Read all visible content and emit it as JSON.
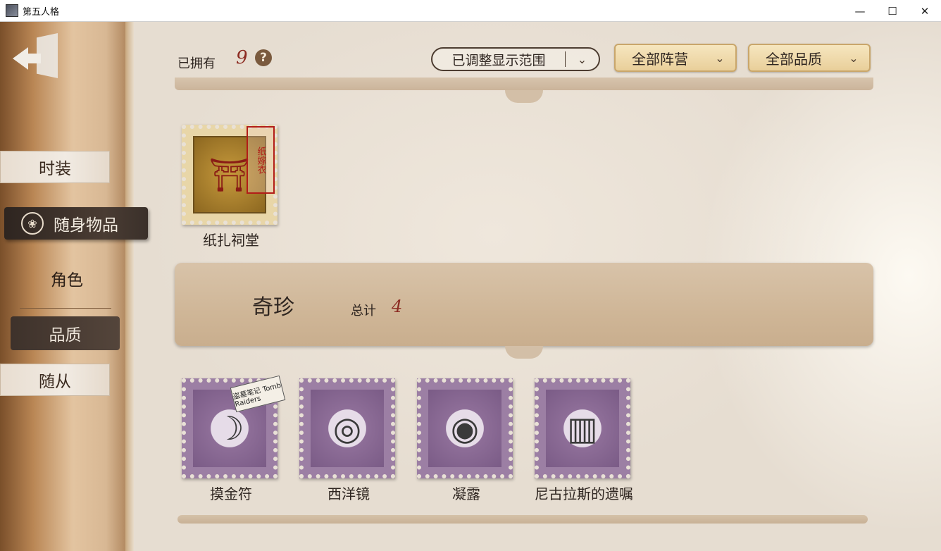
{
  "window": {
    "title": "第五人格",
    "minimize_glyph": "—",
    "maximize_glyph": "☐",
    "close_glyph": "✕"
  },
  "sidebar": {
    "back_icon": "exit-door-icon",
    "tabs": [
      {
        "label": "时装"
      },
      {
        "label": "随身物品",
        "icon": "shield-icon",
        "active": true
      },
      {
        "label": "角色"
      },
      {
        "label": "品质"
      },
      {
        "label": "随从"
      }
    ]
  },
  "header": {
    "owned_label": "已拥有",
    "owned_count": "9",
    "help_glyph": "?",
    "range_dropdown": "已调整显示范围",
    "faction_dropdown": "全部阵营",
    "quality_dropdown": "全部品质"
  },
  "section_top": {
    "items": [
      {
        "name": "纸扎祠堂",
        "badge": "纸嫁衣",
        "stamp_color": "gold"
      }
    ]
  },
  "section_rare": {
    "title": "奇珍",
    "total_label": "总计",
    "total_count": "4",
    "items": [
      {
        "name": "摸金符",
        "badge": "盗墓笔记 Tomb Raiders",
        "stamp_color": "purple"
      },
      {
        "name": "西洋镜",
        "stamp_color": "purple"
      },
      {
        "name": "凝露",
        "stamp_color": "purple"
      },
      {
        "name": "尼古拉斯的遗嘱",
        "stamp_color": "purple"
      }
    ]
  },
  "colors": {
    "count_red": "#8c2b22",
    "purple_stamp": "#9c7fa4",
    "gold_stamp": "#e8d6a8",
    "active_tab": "#2e2520"
  }
}
